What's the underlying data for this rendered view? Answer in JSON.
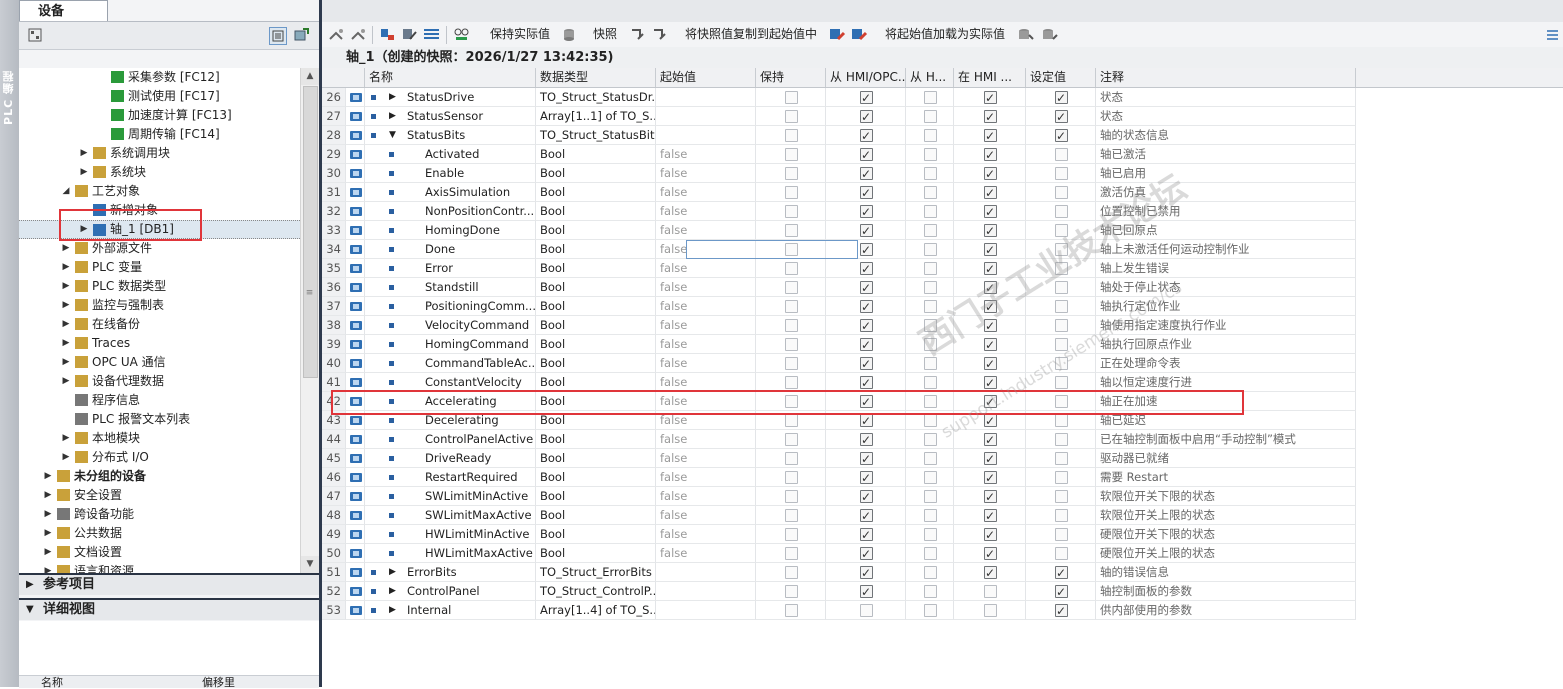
{
  "left_strip": {
    "label": "PLC 编程"
  },
  "device_tab": {
    "label": "设备"
  },
  "tree": {
    "items": [
      {
        "label": "采集参数 [FC12]",
        "indent": 4,
        "expander": "",
        "icon": "fc-block-icon"
      },
      {
        "label": "测试使用 [FC17]",
        "indent": 4,
        "expander": "",
        "icon": "fc-block-icon"
      },
      {
        "label": "加速度计算 [FC13]",
        "indent": 4,
        "expander": "",
        "icon": "fc-block-icon"
      },
      {
        "label": "周期传输 [FC14]",
        "indent": 4,
        "expander": "",
        "icon": "fc-block-icon"
      },
      {
        "label": "系统调用块",
        "indent": 3,
        "expander": "right",
        "icon": "folder-icon"
      },
      {
        "label": "系统块",
        "indent": 3,
        "expander": "right",
        "icon": "folder-icon"
      },
      {
        "label": "工艺对象",
        "indent": 2,
        "expander": "down",
        "icon": "technology-objects-icon"
      },
      {
        "label": "新增对象",
        "indent": 3,
        "expander": "",
        "icon": "add-object-icon"
      },
      {
        "label": "轴_1 [DB1]",
        "indent": 3,
        "expander": "right",
        "icon": "axis-icon"
      },
      {
        "label": "外部源文件",
        "indent": 2,
        "expander": "right",
        "icon": "folder-icon"
      },
      {
        "label": "PLC 变量",
        "indent": 2,
        "expander": "right",
        "icon": "folder-icon"
      },
      {
        "label": "PLC 数据类型",
        "indent": 2,
        "expander": "right",
        "icon": "folder-icon"
      },
      {
        "label": "监控与强制表",
        "indent": 2,
        "expander": "right",
        "icon": "folder-icon"
      },
      {
        "label": "在线备份",
        "indent": 2,
        "expander": "right",
        "icon": "folder-icon"
      },
      {
        "label": "Traces",
        "indent": 2,
        "expander": "right",
        "icon": "folder-icon"
      },
      {
        "label": "OPC UA 通信",
        "indent": 2,
        "expander": "right",
        "icon": "folder-icon"
      },
      {
        "label": "设备代理数据",
        "indent": 2,
        "expander": "right",
        "icon": "folder-icon"
      },
      {
        "label": "程序信息",
        "indent": 2,
        "expander": "",
        "icon": "program-info-icon"
      },
      {
        "label": "PLC 报警文本列表",
        "indent": 2,
        "expander": "",
        "icon": "alarm-text-icon"
      },
      {
        "label": "本地模块",
        "indent": 2,
        "expander": "right",
        "icon": "folder-icon"
      },
      {
        "label": "分布式 I/O",
        "indent": 2,
        "expander": "right",
        "icon": "folder-icon"
      },
      {
        "label": "未分组的设备",
        "indent": 1,
        "expander": "right",
        "icon": "folder-icon",
        "bold": true
      },
      {
        "label": "安全设置",
        "indent": 1,
        "expander": "right",
        "icon": "security-icon"
      },
      {
        "label": "跨设备功能",
        "indent": 1,
        "expander": "right",
        "icon": "cross-device-icon"
      },
      {
        "label": "公共数据",
        "indent": 1,
        "expander": "right",
        "icon": "folder-icon"
      },
      {
        "label": "文档设置",
        "indent": 1,
        "expander": "right",
        "icon": "folder-icon"
      },
      {
        "label": "语言和资源",
        "indent": 1,
        "expander": "right",
        "icon": "folder-icon"
      }
    ],
    "selected_index": 8
  },
  "reference_panel": {
    "label": "参考项目"
  },
  "details_panel": {
    "label": "详细视图",
    "col_name": "名称",
    "col_offset": "偏移里"
  },
  "toolbar": {
    "keep_actual": "保持实际值",
    "snapshot": "快照",
    "copy_snapshot": "将快照值复制到起始值中",
    "load_start": "将起始值加载为实际值"
  },
  "editor_title": "轴_1（创建的快照：2026/1/27 13:42:35)",
  "columns": [
    "名称",
    "数据类型",
    "起始值",
    "保持",
    "从 HMI/OPC...",
    "从 H...",
    "在 HMI ...",
    "设定值",
    "注释"
  ],
  "rows": [
    {
      "num": "26",
      "name": "StatusDrive",
      "type": "TO_Struct_StatusDr...",
      "start": "",
      "level": 1,
      "expander": "right",
      "hmi1": true,
      "hmi2": false,
      "hmi3": true,
      "setp": true,
      "comment": "状态"
    },
    {
      "num": "27",
      "name": "StatusSensor",
      "type": "Array[1..1] of TO_S...",
      "start": "",
      "level": 1,
      "expander": "right",
      "hmi1": true,
      "hmi2": false,
      "hmi3": true,
      "setp": true,
      "comment": "状态"
    },
    {
      "num": "28",
      "name": "StatusBits",
      "type": "TO_Struct_StatusBits",
      "start": "",
      "level": 1,
      "expander": "down",
      "hmi1": true,
      "hmi2": false,
      "hmi3": true,
      "setp": true,
      "comment": "轴的状态信息"
    },
    {
      "num": "29",
      "name": "Activated",
      "type": "Bool",
      "start": "false",
      "level": 2,
      "expander": "",
      "hmi1": true,
      "hmi2": false,
      "hmi3": true,
      "setp": false,
      "comment": "轴已激活"
    },
    {
      "num": "30",
      "name": "Enable",
      "type": "Bool",
      "start": "false",
      "level": 2,
      "expander": "",
      "hmi1": true,
      "hmi2": false,
      "hmi3": true,
      "setp": false,
      "comment": "轴已启用"
    },
    {
      "num": "31",
      "name": "AxisSimulation",
      "type": "Bool",
      "start": "false",
      "level": 2,
      "expander": "",
      "hmi1": true,
      "hmi2": false,
      "hmi3": true,
      "setp": false,
      "comment": "激活仿真"
    },
    {
      "num": "32",
      "name": "NonPositionContr...",
      "type": "Bool",
      "start": "false",
      "level": 2,
      "expander": "",
      "hmi1": true,
      "hmi2": false,
      "hmi3": true,
      "setp": false,
      "comment": "位置控制已禁用"
    },
    {
      "num": "33",
      "name": "HomingDone",
      "type": "Bool",
      "start": "false",
      "level": 2,
      "expander": "",
      "hmi1": true,
      "hmi2": false,
      "hmi3": true,
      "setp": false,
      "comment": "轴已回原点"
    },
    {
      "num": "34",
      "name": "Done",
      "type": "Bool",
      "start": "false",
      "level": 2,
      "expander": "",
      "hmi1": true,
      "hmi2": false,
      "hmi3": true,
      "setp": false,
      "comment": "轴上未激活任何运动控制作业"
    },
    {
      "num": "35",
      "name": "Error",
      "type": "Bool",
      "start": "false",
      "level": 2,
      "expander": "",
      "hmi1": true,
      "hmi2": false,
      "hmi3": true,
      "setp": false,
      "comment": "轴上发生错误"
    },
    {
      "num": "36",
      "name": "Standstill",
      "type": "Bool",
      "start": "false",
      "level": 2,
      "expander": "",
      "hmi1": true,
      "hmi2": false,
      "hmi3": true,
      "setp": false,
      "comment": "轴处于停止状态"
    },
    {
      "num": "37",
      "name": "PositioningComm...",
      "type": "Bool",
      "start": "false",
      "level": 2,
      "expander": "",
      "hmi1": true,
      "hmi2": false,
      "hmi3": true,
      "setp": false,
      "comment": "轴执行定位作业"
    },
    {
      "num": "38",
      "name": "VelocityCommand",
      "type": "Bool",
      "start": "false",
      "level": 2,
      "expander": "",
      "hmi1": true,
      "hmi2": false,
      "hmi3": true,
      "setp": false,
      "comment": "轴使用指定速度执行作业"
    },
    {
      "num": "39",
      "name": "HomingCommand",
      "type": "Bool",
      "start": "false",
      "level": 2,
      "expander": "",
      "hmi1": true,
      "hmi2": false,
      "hmi3": true,
      "setp": false,
      "comment": "轴执行回原点作业"
    },
    {
      "num": "40",
      "name": "CommandTableAc...",
      "type": "Bool",
      "start": "false",
      "level": 2,
      "expander": "",
      "hmi1": true,
      "hmi2": false,
      "hmi3": true,
      "setp": false,
      "comment": "正在处理命令表"
    },
    {
      "num": "41",
      "name": "ConstantVelocity",
      "type": "Bool",
      "start": "false",
      "level": 2,
      "expander": "",
      "hmi1": true,
      "hmi2": false,
      "hmi3": true,
      "setp": false,
      "comment": "轴以恒定速度行进"
    },
    {
      "num": "42",
      "name": "Accelerating",
      "type": "Bool",
      "start": "false",
      "level": 2,
      "expander": "",
      "hmi1": true,
      "hmi2": false,
      "hmi3": true,
      "setp": false,
      "comment": "轴正在加速"
    },
    {
      "num": "43",
      "name": "Decelerating",
      "type": "Bool",
      "start": "false",
      "level": 2,
      "expander": "",
      "hmi1": true,
      "hmi2": false,
      "hmi3": true,
      "setp": false,
      "comment": "轴已延迟"
    },
    {
      "num": "44",
      "name": "ControlPanelActive",
      "type": "Bool",
      "start": "false",
      "level": 2,
      "expander": "",
      "hmi1": true,
      "hmi2": false,
      "hmi3": true,
      "setp": false,
      "comment": "已在轴控制面板中启用“手动控制”模式"
    },
    {
      "num": "45",
      "name": "DriveReady",
      "type": "Bool",
      "start": "false",
      "level": 2,
      "expander": "",
      "hmi1": true,
      "hmi2": false,
      "hmi3": true,
      "setp": false,
      "comment": "驱动器已就绪"
    },
    {
      "num": "46",
      "name": "RestartRequired",
      "type": "Bool",
      "start": "false",
      "level": 2,
      "expander": "",
      "hmi1": true,
      "hmi2": false,
      "hmi3": true,
      "setp": false,
      "comment": "需要 Restart"
    },
    {
      "num": "47",
      "name": "SWLimitMinActive",
      "type": "Bool",
      "start": "false",
      "level": 2,
      "expander": "",
      "hmi1": true,
      "hmi2": false,
      "hmi3": true,
      "setp": false,
      "comment": "软限位开关下限的状态"
    },
    {
      "num": "48",
      "name": "SWLimitMaxActive",
      "type": "Bool",
      "start": "false",
      "level": 2,
      "expander": "",
      "hmi1": true,
      "hmi2": false,
      "hmi3": true,
      "setp": false,
      "comment": "软限位开关上限的状态"
    },
    {
      "num": "49",
      "name": "HWLimitMinActive",
      "type": "Bool",
      "start": "false",
      "level": 2,
      "expander": "",
      "hmi1": true,
      "hmi2": false,
      "hmi3": true,
      "setp": false,
      "comment": "硬限位开关下限的状态"
    },
    {
      "num": "50",
      "name": "HWLimitMaxActive",
      "type": "Bool",
      "start": "false",
      "level": 2,
      "expander": "",
      "hmi1": true,
      "hmi2": false,
      "hmi3": true,
      "setp": false,
      "comment": "硬限位开关上限的状态"
    },
    {
      "num": "51",
      "name": "ErrorBits",
      "type": "TO_Struct_ErrorBits",
      "start": "",
      "level": 1,
      "expander": "right",
      "hmi1": true,
      "hmi2": false,
      "hmi3": true,
      "setp": true,
      "comment": "轴的错误信息"
    },
    {
      "num": "52",
      "name": "ControlPanel",
      "type": "TO_Struct_ControlP...",
      "start": "",
      "level": 1,
      "expander": "right",
      "hmi1": true,
      "hmi2": false,
      "hmi3": false,
      "setp": true,
      "comment": "轴控制面板的参数"
    },
    {
      "num": "53",
      "name": "Internal",
      "type": "Array[1..4] of TO_S...",
      "start": "",
      "level": 1,
      "expander": "right",
      "hmi1": false,
      "hmi2": false,
      "hmi3": false,
      "setp": true,
      "comment": "供内部使用的参数"
    }
  ],
  "watermark": {
    "text": "西门子工业技术论坛",
    "url": "support.industry.siemens.com/cs"
  },
  "colors": {
    "highlight_red": "#e0353a",
    "selection_blue": "#6c98c8",
    "splitter": "#2e3a4e"
  }
}
